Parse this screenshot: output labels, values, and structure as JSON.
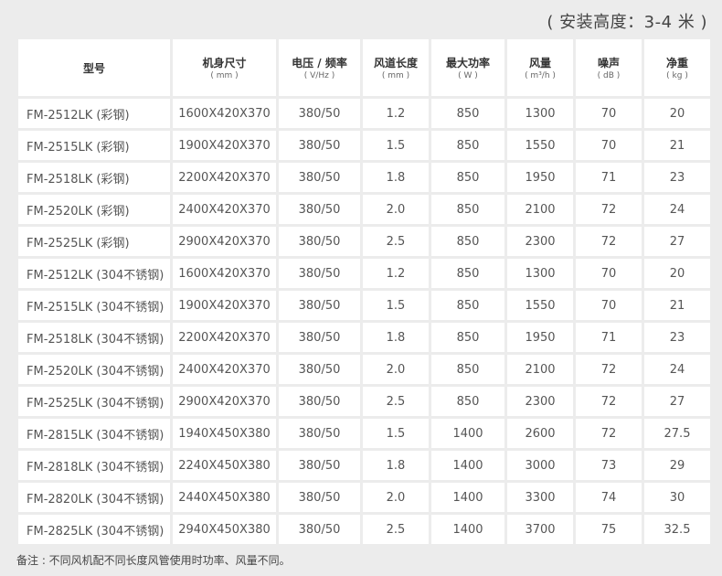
{
  "install_note": "( 安装高度：3-4 米 )",
  "columns": [
    {
      "name": "型号",
      "unit": ""
    },
    {
      "name": "机身尺寸",
      "unit": "( mm )"
    },
    {
      "name": "电压 / 频率",
      "unit": "( V/Hz )"
    },
    {
      "name": "风道长度",
      "unit": "( mm )"
    },
    {
      "name": "最大功率",
      "unit": "( W )"
    },
    {
      "name": "风量",
      "unit": "( m³/h )"
    },
    {
      "name": "噪声",
      "unit": "( dB )"
    },
    {
      "name": "净重",
      "unit": "( kg )"
    }
  ],
  "rows": [
    [
      "FM-2512LK (彩钢)",
      "1600X420X370",
      "380/50",
      "1.2",
      "850",
      "1300",
      "70",
      "20"
    ],
    [
      "FM-2515LK (彩钢)",
      "1900X420X370",
      "380/50",
      "1.5",
      "850",
      "1550",
      "70",
      "21"
    ],
    [
      "FM-2518LK (彩钢)",
      "2200X420X370",
      "380/50",
      "1.8",
      "850",
      "1950",
      "71",
      "23"
    ],
    [
      "FM-2520LK (彩钢)",
      "2400X420X370",
      "380/50",
      "2.0",
      "850",
      "2100",
      "72",
      "24"
    ],
    [
      "FM-2525LK (彩钢)",
      "2900X420X370",
      "380/50",
      "2.5",
      "850",
      "2300",
      "72",
      "27"
    ],
    [
      "FM-2512LK (304不锈钢)",
      "1600X420X370",
      "380/50",
      "1.2",
      "850",
      "1300",
      "70",
      "20"
    ],
    [
      "FM-2515LK (304不锈钢)",
      "1900X420X370",
      "380/50",
      "1.5",
      "850",
      "1550",
      "70",
      "21"
    ],
    [
      "FM-2518LK (304不锈钢)",
      "2200X420X370",
      "380/50",
      "1.8",
      "850",
      "1950",
      "71",
      "23"
    ],
    [
      "FM-2520LK (304不锈钢)",
      "2400X420X370",
      "380/50",
      "2.0",
      "850",
      "2100",
      "72",
      "24"
    ],
    [
      "FM-2525LK (304不锈钢)",
      "2900X420X370",
      "380/50",
      "2.5",
      "850",
      "2300",
      "72",
      "27"
    ],
    [
      "FM-2815LK (304不锈钢)",
      "1940X450X380",
      "380/50",
      "1.5",
      "1400",
      "2600",
      "72",
      "27.5"
    ],
    [
      "FM-2818LK (304不锈钢)",
      "2240X450X380",
      "380/50",
      "1.8",
      "1400",
      "3000",
      "73",
      "29"
    ],
    [
      "FM-2820LK (304不锈钢)",
      "2440X450X380",
      "380/50",
      "2.0",
      "1400",
      "3300",
      "74",
      "30"
    ],
    [
      "FM-2825LK (304不锈钢)",
      "2940X450X380",
      "380/50",
      "2.5",
      "1400",
      "3700",
      "75",
      "32.5"
    ]
  ],
  "footnote": "备注 : 不同风机配不同长度风管使用时功率、风量不同。"
}
